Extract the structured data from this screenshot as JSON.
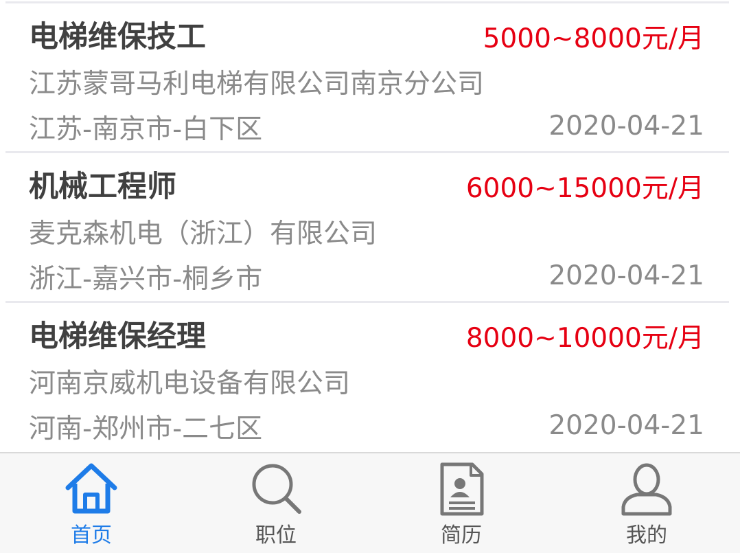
{
  "jobs": [
    {
      "title": "电梯维保技工",
      "salary": "5000~8000元/月",
      "company": "江苏蒙哥马利电梯有限公司南京分公司",
      "location": "江苏-南京市-白下区",
      "date": "2020-04-21"
    },
    {
      "title": "机械工程师",
      "salary": "6000~15000元/月",
      "company": "麦克森机电（浙江）有限公司",
      "location": "浙江-嘉兴市-桐乡市",
      "date": "2020-04-21"
    },
    {
      "title": "电梯维保经理",
      "salary": "8000~10000元/月",
      "company": "河南京威机电设备有限公司",
      "location": "河南-郑州市-二七区",
      "date": "2020-04-21"
    }
  ],
  "tabbar": {
    "items": [
      {
        "label": "首页",
        "icon": "home-icon",
        "active": true
      },
      {
        "label": "职位",
        "icon": "search-icon",
        "active": false
      },
      {
        "label": "简历",
        "icon": "resume-icon",
        "active": false
      },
      {
        "label": "我的",
        "icon": "user-icon",
        "active": false
      }
    ]
  },
  "colors": {
    "salary": "#e60012",
    "active_tab": "#1e7ce8",
    "inactive_tab": "#555555",
    "title": "#404040",
    "secondary_text": "#8a8a8a"
  }
}
